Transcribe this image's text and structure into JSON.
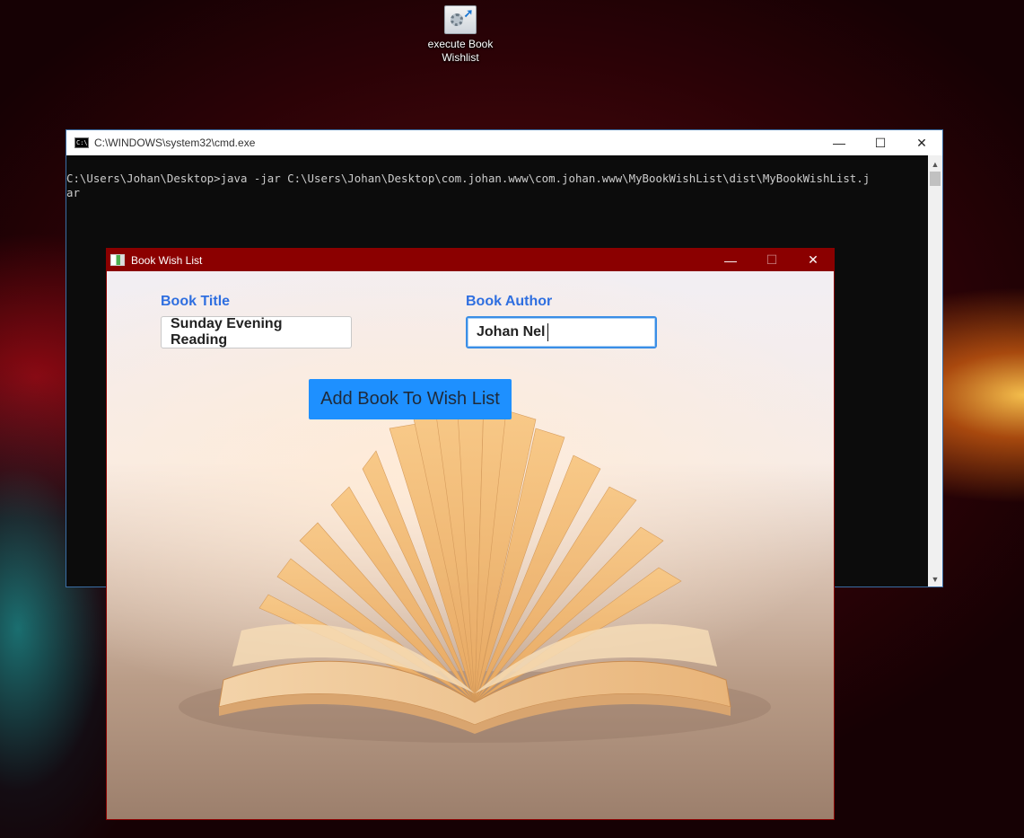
{
  "desktop": {
    "icon_label": "execute Book Wishlist"
  },
  "cmd_window": {
    "title": "C:\\WINDOWS\\system32\\cmd.exe",
    "icon_text": "C:\\",
    "output": "C:\\Users\\Johan\\Desktop>java -jar C:\\Users\\Johan\\Desktop\\com.johan.www\\com.johan.www\\MyBookWishList\\dist\\MyBookWishList.j\nar"
  },
  "app_window": {
    "title": "Book Wish List",
    "book_title": {
      "label": "Book Title",
      "value": "Sunday Evening Reading"
    },
    "book_author": {
      "label": "Book Author",
      "value": "Johan Nel"
    },
    "add_button_label": "Add Book To Wish List"
  },
  "controls": {
    "minimize": "—",
    "maximize": "☐",
    "close": "✕"
  },
  "colors": {
    "app_titlebar": "#8b0000",
    "field_label": "#2f6fe0",
    "button": "#1e90ff"
  }
}
